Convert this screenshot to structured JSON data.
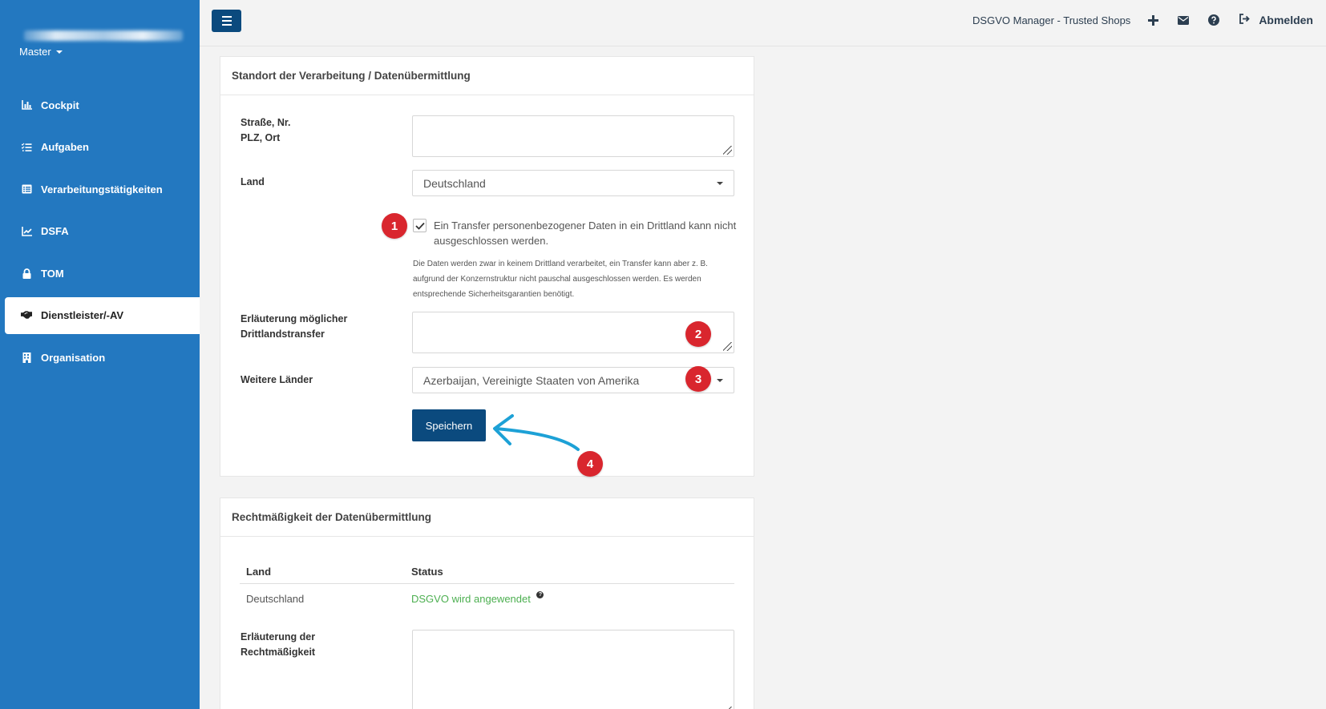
{
  "sidebar": {
    "account": "Master",
    "items": [
      {
        "label": "Cockpit",
        "icon": "bar-chart-icon"
      },
      {
        "label": "Aufgaben",
        "icon": "task-list-icon"
      },
      {
        "label": "Verarbeitungstätigkeiten",
        "icon": "table-list-icon"
      },
      {
        "label": "DSFA",
        "icon": "line-chart-icon"
      },
      {
        "label": "TOM",
        "icon": "lock-icon"
      },
      {
        "label": "Dienstleister/-AV",
        "icon": "handshake-icon",
        "active": true
      },
      {
        "label": "Organisation",
        "icon": "building-icon"
      }
    ]
  },
  "topbar": {
    "app_title": "DSGVO Manager - Trusted Shops",
    "logout_label": "Abmelden",
    "icons": [
      "plus-icon",
      "envelope-icon",
      "question-circle-icon",
      "sign-out-icon"
    ]
  },
  "location_panel": {
    "title": "Standort der Verarbeitung / Datenübermittlung",
    "street_label_line1": "Straße, Nr.",
    "street_label_line2": "PLZ, Ort",
    "street_value": "",
    "country_label": "Land",
    "country_value": "Deutschland",
    "third_country_checked": true,
    "third_country_checkbox_label": "Ein Transfer personenbezogener Daten in ein Drittland kann nicht ausgeschlossen werden.",
    "third_country_help": "Die Daten werden zwar in keinem Drittland verarbeitet, ein Transfer kann aber z. B. aufgrund der Konzernstruktur nicht pauschal ausgeschlossen werden. Es werden entsprechende Sicherheitsgarantien benötigt.",
    "explanation_label_line1": "Erläuterung möglicher",
    "explanation_label_line2": "Drittlandstransfer",
    "explanation_value": "",
    "more_countries_label": "Weitere Länder",
    "more_countries_value": "Azerbaijan, Vereinigte Staaten von Amerika",
    "save_label": "Speichern"
  },
  "annotations": [
    "1",
    "2",
    "3",
    "4"
  ],
  "annotation_color": "#d9262e",
  "arrow_color": "#1da1d6",
  "legality_panel": {
    "title": "Rechtmäßigkeit der Datenübermittlung",
    "columns": [
      "Land",
      "Status"
    ],
    "rows": [
      {
        "country": "Deutschland",
        "status": "DSGVO wird angewendet"
      }
    ],
    "explanation_label_line1": "Erläuterung der",
    "explanation_label_line2": "Rechtmäßigkeit",
    "explanation_value": ""
  },
  "colors": {
    "sidebar_bg": "#2378c0",
    "primary_button": "#0b4a7e",
    "status_ok": "#4caf50"
  }
}
